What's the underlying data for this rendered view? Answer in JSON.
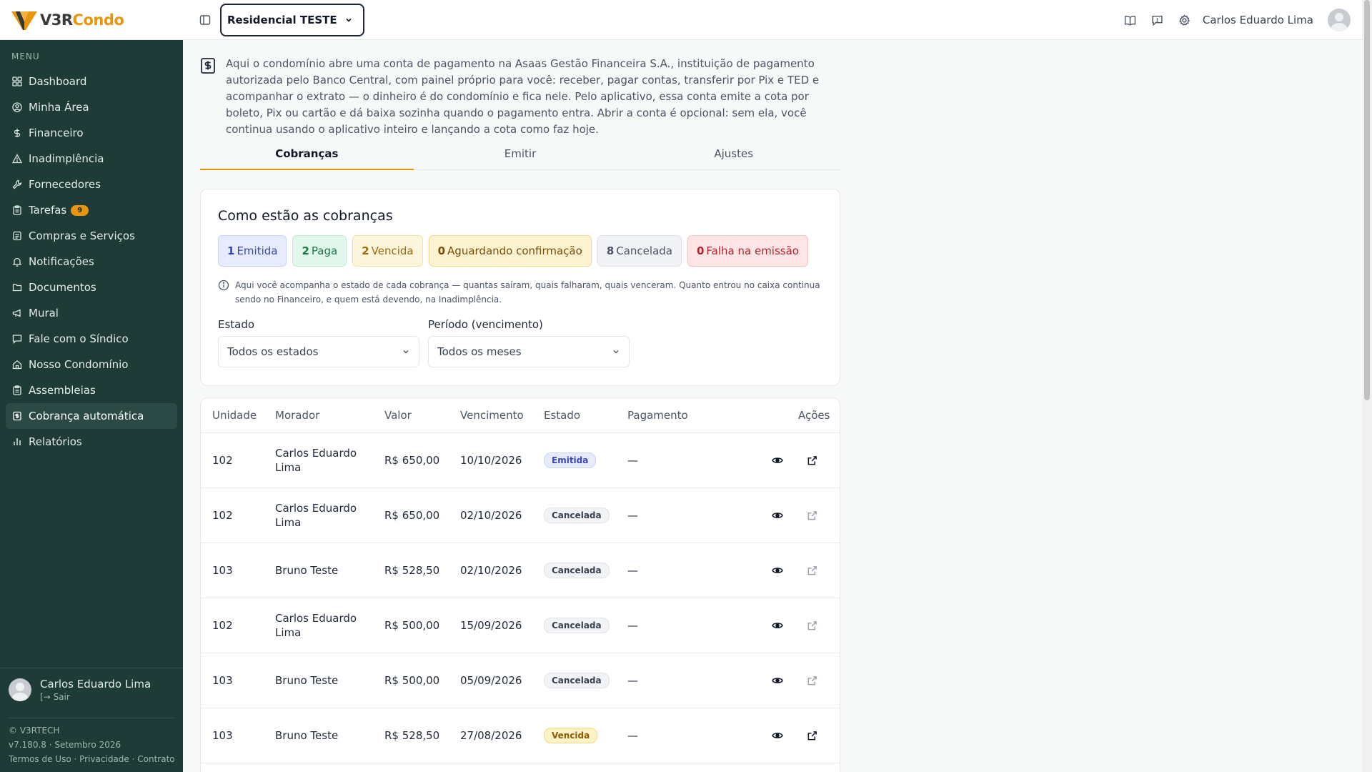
{
  "header": {
    "logo_v3r": "V3R",
    "logo_condo": "Condo",
    "condo_selector": "Residencial TESTE",
    "user_name": "Carlos Eduardo Lima"
  },
  "sidebar": {
    "menu_label": "MENU",
    "items": [
      {
        "label": "Dashboard",
        "icon": "dashboard-icon"
      },
      {
        "label": "Minha Área",
        "icon": "user-circle-icon"
      },
      {
        "label": "Financeiro",
        "icon": "dollar-icon"
      },
      {
        "label": "Inadimplência",
        "icon": "warning-icon"
      },
      {
        "label": "Fornecedores",
        "icon": "wrench-icon"
      },
      {
        "label": "Tarefas",
        "icon": "clipboard-icon",
        "badge": "9"
      },
      {
        "label": "Compras e Serviços",
        "icon": "receipt-icon"
      },
      {
        "label": "Notificações",
        "icon": "bell-icon"
      },
      {
        "label": "Documentos",
        "icon": "folder-icon"
      },
      {
        "label": "Mural",
        "icon": "megaphone-icon"
      },
      {
        "label": "Fale com o Síndico",
        "icon": "chat-icon"
      },
      {
        "label": "Nosso Condomínio",
        "icon": "home-icon"
      },
      {
        "label": "Assembleias",
        "icon": "clipboard-icon"
      },
      {
        "label": "Cobrança automática",
        "icon": "billing-icon",
        "active": true
      },
      {
        "label": "Relatórios",
        "icon": "bar-chart-icon"
      }
    ],
    "user_name": "Carlos Eduardo Lima",
    "logout": "Sair",
    "copyright": "© V3RTECH",
    "version": "v7.180.8 · Setembro 2026",
    "links": [
      "Termos de Uso",
      "Privacidade",
      "Contrato"
    ]
  },
  "intro_text": "Aqui o condomínio abre uma conta de pagamento na Asaas Gestão Financeira S.A., instituição de pagamento autorizada pelo Banco Central, com painel próprio para você: receber, pagar contas, transferir por Pix e TED e acompanhar o extrato — o dinheiro é do condomínio e fica nele. Pelo aplicativo, essa conta emite a cota por boleto, Pix ou cartão e dá baixa sozinha quando o pagamento entra. Abrir a conta é opcional: sem ela, você continua usando o aplicativo inteiro e lançando a cota como faz hoje.",
  "tabs": [
    "Cobranças",
    "Emitir",
    "Ajustes"
  ],
  "status_card": {
    "title": "Como estão as cobranças",
    "chips": [
      {
        "count": "1",
        "label": "Emitida",
        "class": "emitida"
      },
      {
        "count": "2",
        "label": "Paga",
        "class": "paga"
      },
      {
        "count": "2",
        "label": "Vencida",
        "class": "vencida"
      },
      {
        "count": "0",
        "label": "Aguardando confirmação",
        "class": "aguardando"
      },
      {
        "count": "8",
        "label": "Cancelada",
        "class": "cancelada"
      },
      {
        "count": "0",
        "label": "Falha na emissão",
        "class": "falha"
      }
    ],
    "info": "Aqui você acompanha o estado de cada cobrança — quantas saíram, quais falharam, quais venceram. Quanto entrou no caixa continua sendo no Financeiro, e quem está devendo, na Inadimplência.",
    "filter_estado_label": "Estado",
    "filter_estado_value": "Todos os estados",
    "filter_periodo_label": "Período (vencimento)",
    "filter_periodo_value": "Todos os meses"
  },
  "table": {
    "headers": {
      "unidade": "Unidade",
      "morador": "Morador",
      "valor": "Valor",
      "vencimento": "Vencimento",
      "estado": "Estado",
      "pagamento": "Pagamento",
      "acoes": "Ações"
    },
    "rows": [
      {
        "unidade": "102",
        "morador": "Carlos Eduardo Lima",
        "valor": "R$ 650,00",
        "vencimento": "10/10/2026",
        "estado": "Emitida",
        "pagamento": "—",
        "link_enabled": true
      },
      {
        "unidade": "102",
        "morador": "Carlos Eduardo Lima",
        "valor": "R$ 650,00",
        "vencimento": "02/10/2026",
        "estado": "Cancelada",
        "pagamento": "—",
        "link_enabled": false
      },
      {
        "unidade": "103",
        "morador": "Bruno Teste",
        "valor": "R$ 528,50",
        "vencimento": "02/10/2026",
        "estado": "Cancelada",
        "pagamento": "—",
        "link_enabled": false
      },
      {
        "unidade": "102",
        "morador": "Carlos Eduardo Lima",
        "valor": "R$ 500,00",
        "vencimento": "15/09/2026",
        "estado": "Cancelada",
        "pagamento": "—",
        "link_enabled": false
      },
      {
        "unidade": "103",
        "morador": "Bruno Teste",
        "valor": "R$ 500,00",
        "vencimento": "05/09/2026",
        "estado": "Cancelada",
        "pagamento": "—",
        "link_enabled": false
      },
      {
        "unidade": "103",
        "morador": "Bruno Teste",
        "valor": "R$ 528,50",
        "vencimento": "27/08/2026",
        "estado": "Vencida",
        "pagamento": "—",
        "link_enabled": true
      }
    ]
  },
  "colors": {
    "sidebar_bg": "#1f3b37",
    "accent": "#e8950c"
  }
}
